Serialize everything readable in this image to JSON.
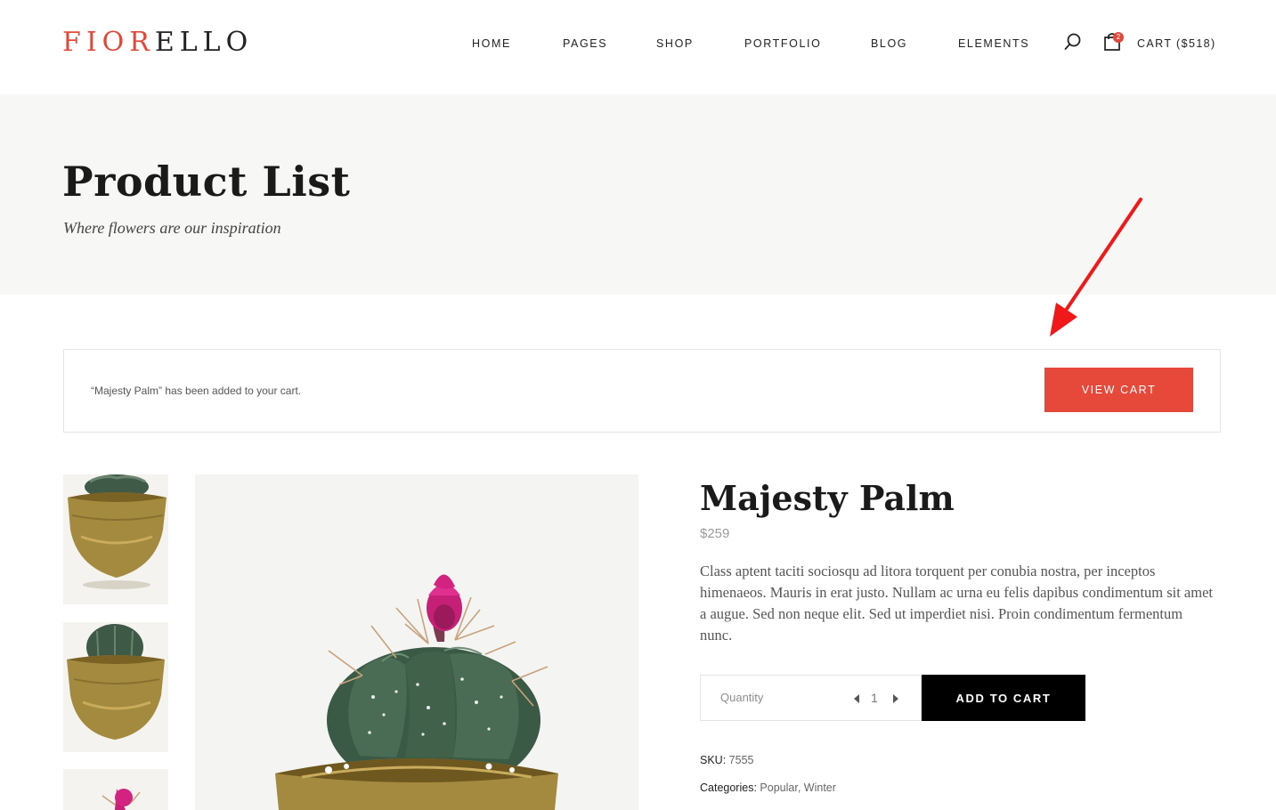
{
  "header": {
    "logo_part1": "FIOR",
    "logo_part2": "ELLO",
    "nav": [
      "HOME",
      "PAGES",
      "SHOP",
      "PORTFOLIO",
      "BLOG",
      "ELEMENTS"
    ],
    "cart_count": "2",
    "cart_label": "CART ($518)"
  },
  "hero": {
    "title": "Product List",
    "subtitle": "Where flowers are our inspiration"
  },
  "notice": {
    "message": "“Majesty Palm” has been added to your cart.",
    "button": "VIEW CART"
  },
  "product": {
    "title": "Majesty Palm",
    "price": "$259",
    "description": "Class aptent taciti sociosqu ad litora torquent per conubia nostra, per inceptos himenaeos. Mauris in erat justo. Nullam ac urna eu felis dapibus condimentum sit amet a augue. Sed non neque elit. Sed ut imperdiet nisi. Proin condimentum fermentum nunc.",
    "quantity_label": "Quantity",
    "quantity_value": "1",
    "add_to_cart": "ADD TO CART",
    "sku_label": "SKU:",
    "sku_value": "7555",
    "categories_label": "Categories:",
    "categories": [
      "Popular",
      "Winter"
    ]
  },
  "colors": {
    "accent": "#e6493a",
    "hero_bg": "#f7f7f5",
    "button_dark": "#000000"
  },
  "icons": {
    "search": "search-icon",
    "cart": "shopping-bag-icon",
    "annotation": "red-arrow-icon"
  }
}
